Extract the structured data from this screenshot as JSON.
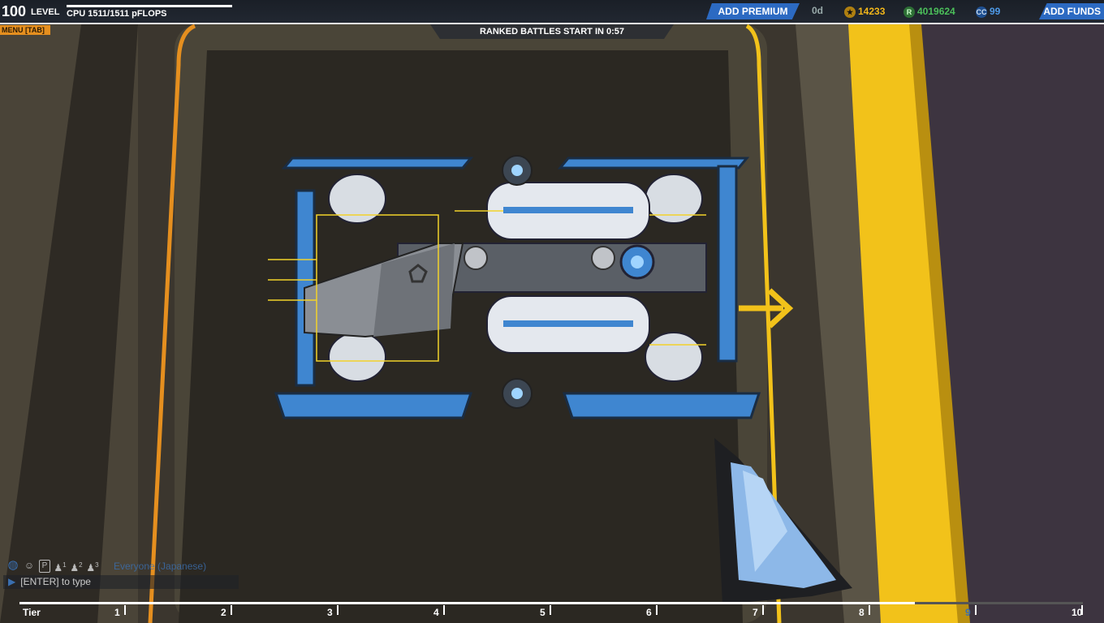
{
  "hud": {
    "level_num": "100",
    "level_label": "LEVEL",
    "cpu_text": "CPU 1511/1511 pFLOPS",
    "cpu_fill": 1.0,
    "menu_tab": "MENU [TAB]",
    "ranked_text": "RANKED BATTLES START IN 0:57",
    "add_premium": "ADD PREMIUM",
    "premium_days": "0d",
    "currency_1": "14233",
    "currency_2": "4019624",
    "currency_3": "99",
    "currency_3_icon": "CC",
    "add_funds": "ADD FUNDS"
  },
  "colors": {
    "accent_blue": "#2c6ac2",
    "orange": "#e58f1f",
    "yellow": "#f2c21a"
  },
  "chat": {
    "channel": "Everyone (Japanese)",
    "placeholder": "[ENTER] to type",
    "icons": [
      "globe-icon",
      "accessibility-icon",
      "party-icon",
      "squad-1-icon",
      "squad-2-icon",
      "squad-3-icon"
    ],
    "icon_labels": [
      "P",
      "1",
      "2",
      "3"
    ]
  },
  "tier": {
    "label": "Tier",
    "ticks": [
      "1",
      "2",
      "3",
      "4",
      "5",
      "6",
      "7",
      "8",
      "9",
      "10"
    ],
    "current": 9
  }
}
